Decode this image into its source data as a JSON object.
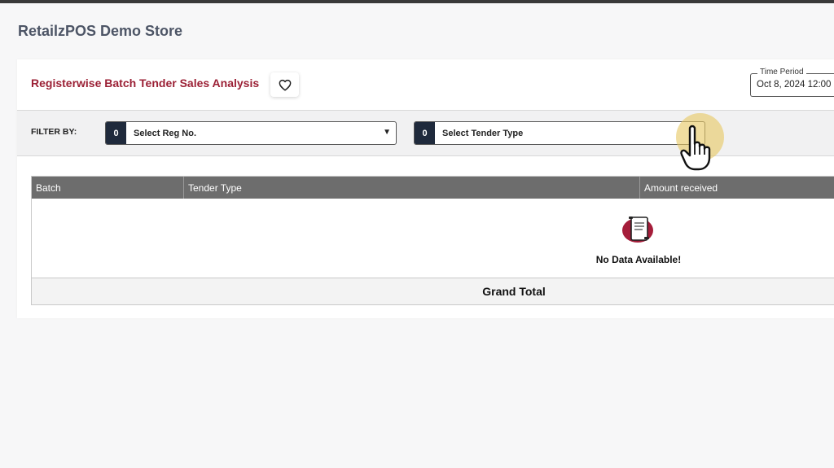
{
  "store": {
    "title": "RetailzPOS Demo Store"
  },
  "report": {
    "title": "Registerwise Batch Tender Sales Analysis",
    "favorite_icon": "heart-outline-icon",
    "time_period": {
      "legend": "Time Period",
      "value": "Oct 8, 2024 12:00"
    }
  },
  "filters": {
    "label": "FILTER BY:",
    "reg_no": {
      "count": "0",
      "placeholder": "Select Reg No.",
      "caret": "▼"
    },
    "tender_type": {
      "count": "0",
      "placeholder": "Select Tender Type"
    }
  },
  "table": {
    "columns": [
      "Batch",
      "Tender Type",
      "Amount received"
    ],
    "empty_message": "No Data Available!",
    "empty_icon": "document-empty-icon",
    "footer": {
      "grand_total_label": "Grand Total"
    }
  },
  "colors": {
    "accent": "#9b2035",
    "header_bg": "#6d6d6d",
    "badge_bg": "#1f2a3c",
    "store_title": "#4d5566"
  },
  "cursor": {
    "icon": "hand-pointer-icon"
  }
}
